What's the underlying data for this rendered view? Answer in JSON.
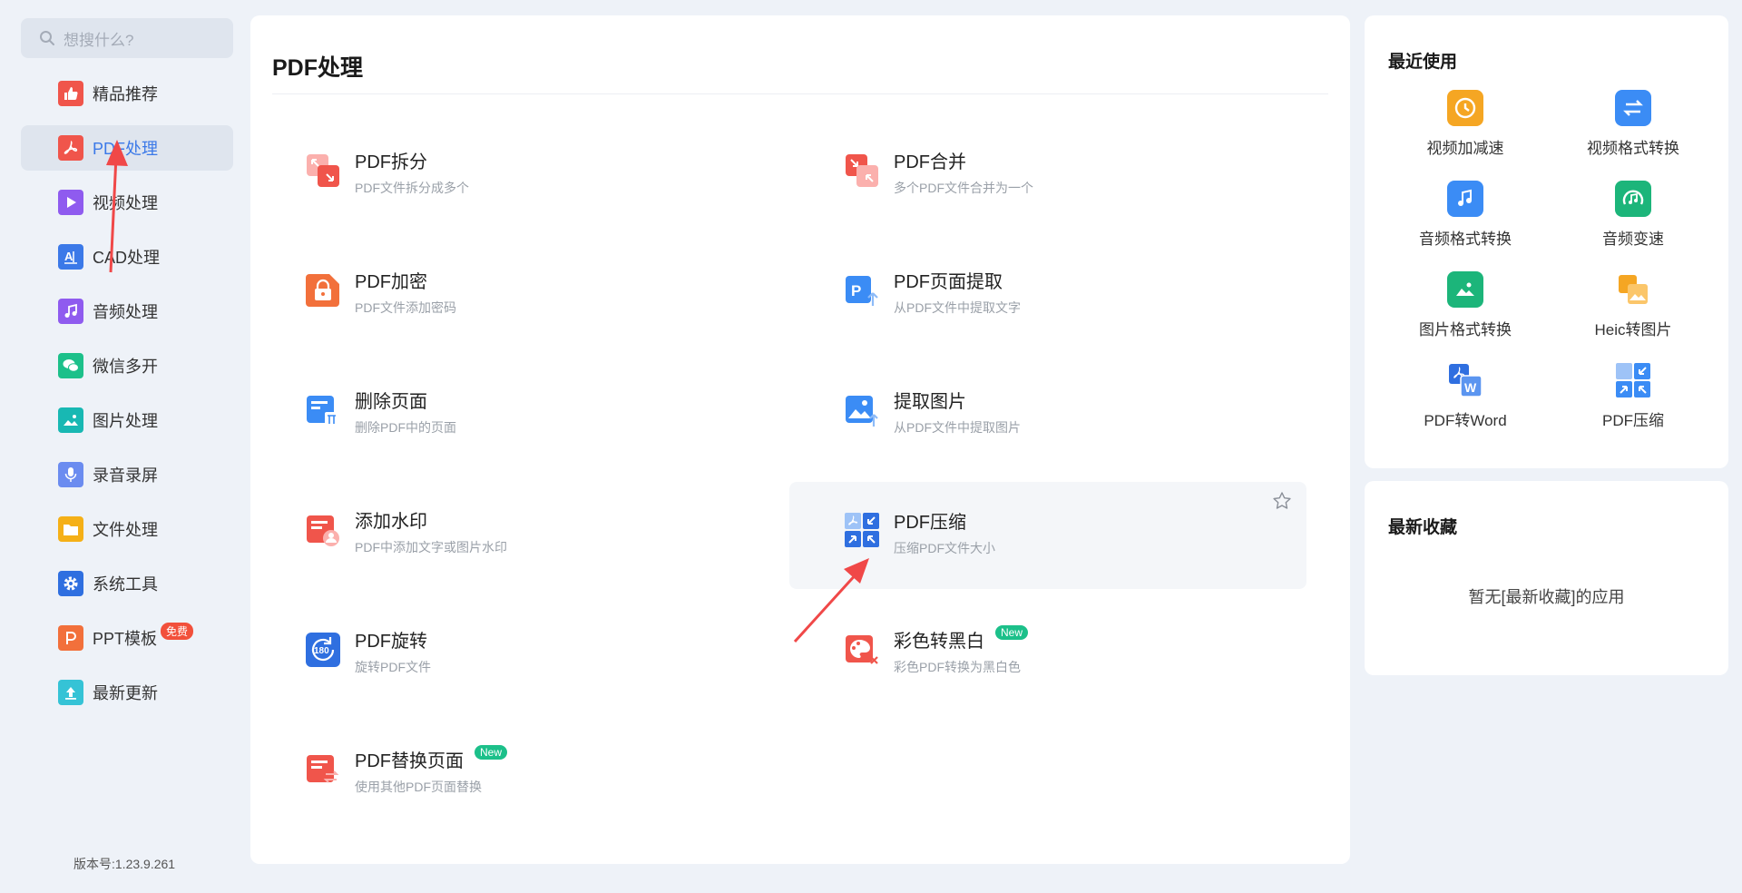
{
  "search": {
    "placeholder": "想搜什么?"
  },
  "sidebar": {
    "items": [
      {
        "label": "精品推荐",
        "color": "#f0554b"
      },
      {
        "label": "PDF处理",
        "color": "#f0554b",
        "active": true
      },
      {
        "label": "视频处理",
        "color": "#8f5bef"
      },
      {
        "label": "CAD处理",
        "color": "#3b79e8"
      },
      {
        "label": "音频处理",
        "color": "#8f5bef"
      },
      {
        "label": "微信多开",
        "color": "#1cc08a"
      },
      {
        "label": "图片处理",
        "color": "#18b8b3"
      },
      {
        "label": "录音录屏",
        "color": "#6b8cf0"
      },
      {
        "label": "文件处理",
        "color": "#f5b017"
      },
      {
        "label": "系统工具",
        "color": "#2f6fe0"
      },
      {
        "label": "PPT模板",
        "color": "#f2703b",
        "badge": "免费"
      },
      {
        "label": "最新更新",
        "color": "#35c3d6"
      }
    ],
    "version": "版本号:1.23.9.261"
  },
  "main": {
    "title": "PDF处理",
    "tools": [
      {
        "name": "PDF拆分",
        "desc": "PDF文件拆分成多个",
        "icon": "split-icon"
      },
      {
        "name": "PDF合并",
        "desc": "多个PDF文件合并为一个",
        "icon": "merge-icon"
      },
      {
        "name": "PDF加密",
        "desc": "PDF文件添加密码",
        "icon": "lock-icon"
      },
      {
        "name": "PDF页面提取",
        "desc": "从PDF文件中提取文字",
        "icon": "extract-page-icon"
      },
      {
        "name": "删除页面",
        "desc": "删除PDF中的页面",
        "icon": "delete-page-icon"
      },
      {
        "name": "提取图片",
        "desc": "从PDF文件中提取图片",
        "icon": "extract-image-icon"
      },
      {
        "name": "添加水印",
        "desc": "PDF中添加文字或图片水印",
        "icon": "watermark-icon"
      },
      {
        "name": "PDF压缩",
        "desc": "压缩PDF文件大小",
        "icon": "compress-icon"
      },
      {
        "name": "PDF旋转",
        "desc": "旋转PDF文件",
        "icon": "rotate-icon"
      },
      {
        "name": "彩色转黑白",
        "desc": "彩色PDF转换为黑白色",
        "icon": "palette-icon",
        "badge": "New"
      },
      {
        "name": "PDF替换页面",
        "desc": "使用其他PDF页面替换",
        "icon": "replace-page-icon",
        "badge": "New"
      }
    ],
    "rotate_icon_text": "180"
  },
  "recent": {
    "title": "最近使用",
    "items": [
      {
        "label": "视频加减速",
        "icon": "video-speed-icon",
        "color": "#f5a623"
      },
      {
        "label": "视频格式转换",
        "icon": "video-convert-icon",
        "color": "#3b8cf5"
      },
      {
        "label": "音频格式转换",
        "icon": "audio-convert-icon",
        "color": "#3b8cf5"
      },
      {
        "label": "音频变速",
        "icon": "audio-speed-icon",
        "color": "#1cb57a"
      },
      {
        "label": "图片格式转换",
        "icon": "image-convert-icon",
        "color": "#1cb57a"
      },
      {
        "label": "Heic转图片",
        "icon": "heic-icon",
        "color": "#f5a623"
      },
      {
        "label": "PDF转Word",
        "icon": "pdf-word-icon",
        "color": "#2f6fe0"
      },
      {
        "label": "PDF压缩",
        "icon": "pdf-compress-icon",
        "color": "#3b8cf5"
      }
    ]
  },
  "favorites": {
    "title": "最新收藏",
    "empty_text": "暂无[最新收藏]的应用"
  }
}
